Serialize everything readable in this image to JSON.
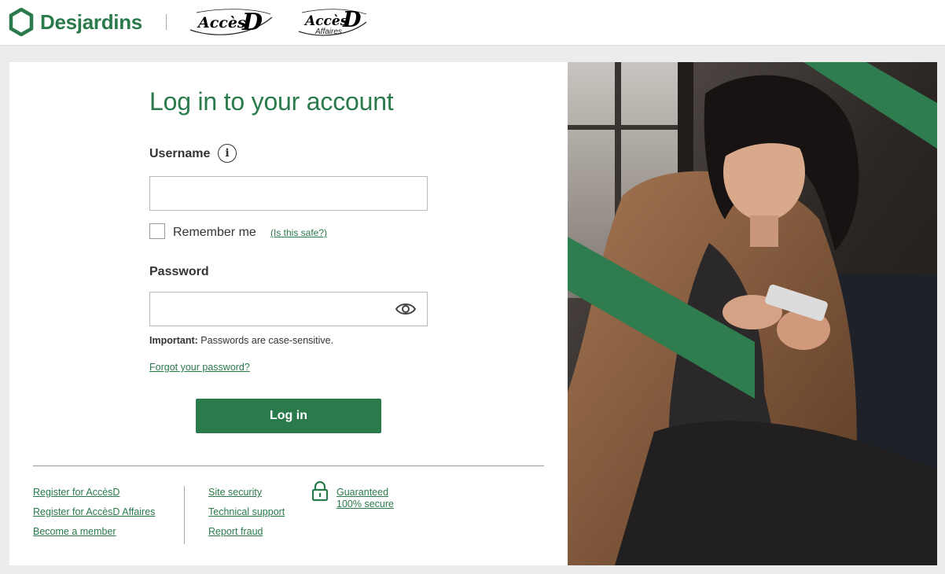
{
  "header": {
    "brand_name": "Desjardins",
    "logo_icon": "hexagon-logo-icon",
    "accesd": {
      "text": "Accès",
      "d": "D"
    },
    "accesd_affaires": {
      "text": "Accès",
      "d": "D",
      "sub": "Affaires"
    }
  },
  "login": {
    "title": "Log in to your account",
    "username_label": "Username",
    "username_value": "",
    "remember_label": "Remember me",
    "safe_link": "(Is this safe?)",
    "password_label": "Password",
    "password_value": "",
    "important_bold": "Important:",
    "important_text": " Passwords are case-sensitive.",
    "forgot_link": "Forgot your password?",
    "login_button": "Log in"
  },
  "footer": {
    "col1": [
      "Register for AccèsD",
      "Register for AccèsD Affaires",
      "Become a member"
    ],
    "col2": [
      "Site security",
      "Technical support",
      "Report fraud"
    ],
    "secure_line1": "Guaranteed",
    "secure_line2": "100% secure"
  },
  "colors": {
    "brand_green": "#2a7a4b",
    "page_bg": "#ececec"
  }
}
